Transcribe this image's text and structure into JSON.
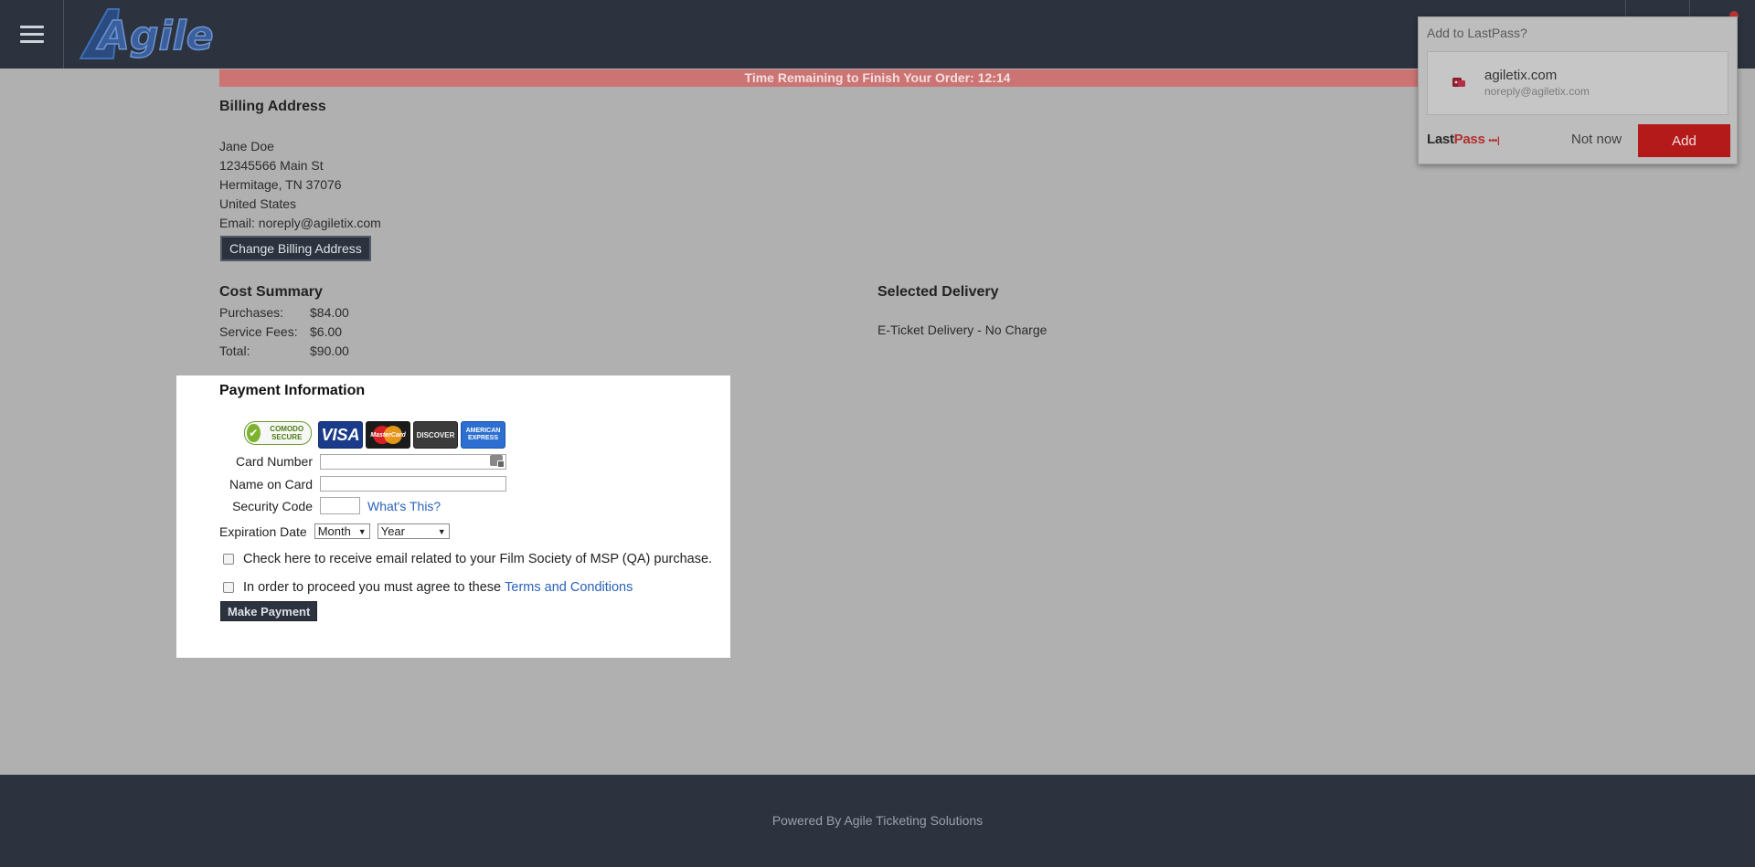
{
  "header": {
    "menu_icon": "hamburger-menu-icon",
    "logo_text": "Agile"
  },
  "timer": {
    "text": "Time Remaining to Finish Your Order: 12:14"
  },
  "billing": {
    "title": "Billing Address",
    "name": "Jane Doe",
    "street": "12345566 Main St",
    "city_state_zip": "Hermitage, TN 37076",
    "country": "United States",
    "email": "Email: noreply@agiletix.com",
    "change_button": "Change Billing Address"
  },
  "cost_summary": {
    "title": "Cost Summary",
    "rows": [
      {
        "label": "Purchases:",
        "value": "$84.00"
      },
      {
        "label": "Service Fees:",
        "value": "$6.00"
      },
      {
        "label": "Total:",
        "value": "$90.00"
      }
    ]
  },
  "delivery": {
    "title": "Selected Delivery",
    "text": "E-Ticket Delivery - No Charge"
  },
  "payment": {
    "title": "Payment Information",
    "comodo_badge": "COMODO SECURE",
    "cards": {
      "visa": "VISA",
      "mastercard": "MasterCard",
      "discover": "DISCOVER",
      "amex_line1": "AMERICAN",
      "amex_line2": "EXPRESS"
    },
    "card_number_label": "Card Number",
    "card_number_value": "",
    "name_on_card_label": "Name on Card",
    "name_on_card_value": "",
    "security_code_label": "Security Code",
    "security_code_value": "",
    "whats_this": "What's This?",
    "expiration_label": "Expiration Date",
    "month_selected": "Month",
    "year_selected": "Year",
    "email_opt_in": "Check here to receive email related to your Film Society of MSP (QA) purchase.",
    "terms_prefix": "In order to proceed you must agree to these",
    "terms_link": "Terms and Conditions",
    "submit_button": "Make Payment"
  },
  "footer": {
    "text": "Powered By Agile Ticketing Solutions"
  },
  "lastpass": {
    "title": "Add to LastPass?",
    "site": "agiletix.com",
    "username": "noreply@agiletix.com",
    "brand_last": "Last",
    "brand_pass": "Pass",
    "brand_dots": "•••|",
    "not_now": "Not now",
    "add": "Add"
  },
  "colors": {
    "header_bg": "#2c323e",
    "timer_bg": "#cc7474",
    "page_bg": "#b0b0b0",
    "link": "#2a62b8",
    "lastpass_red": "#b51a1a"
  }
}
